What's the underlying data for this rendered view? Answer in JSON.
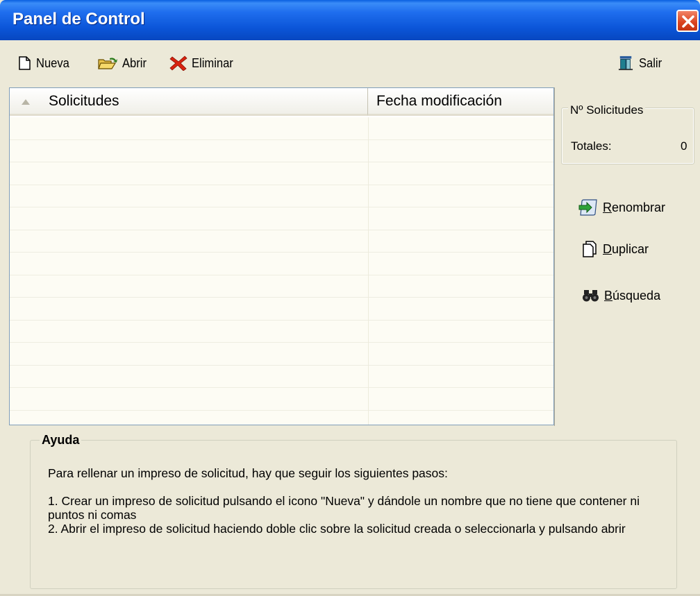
{
  "window": {
    "title": "Panel de Control"
  },
  "toolbar": {
    "new_label": "Nueva",
    "open_label": "Abrir",
    "delete_label": "Eliminar",
    "exit_label": "Salir"
  },
  "list": {
    "columns": [
      "Solicitudes",
      "Fecha modificación"
    ],
    "sorted_column": "Solicitudes",
    "rows": []
  },
  "counts": {
    "group_title": "Nº Solicitudes",
    "totals_label": "Totales:",
    "totals_value": "0"
  },
  "actions": {
    "rename_label": "enombrar",
    "rename_accel": "R",
    "duplicate_label": "uplicar",
    "duplicate_accel": "D",
    "search_label": "úsqueda",
    "search_accel": "B"
  },
  "help": {
    "title": "Ayuda",
    "intro": "Para rellenar un impreso de solicitud, hay que seguir los siguientes pasos:",
    "step1": "1. Crear un impreso de solicitud pulsando el icono \"Nueva\" y dándole un nombre que no tiene que contener ni puntos ni comas",
    "step2": "2. Abrir el impreso de solicitud haciendo doble clic sobre la solicitud creada o seleccionarla y pulsando abrir"
  },
  "icons": {
    "new": "new-document-icon",
    "open": "open-folder-icon",
    "delete": "delete-x-icon",
    "exit": "exit-door-icon",
    "rename": "rename-icon",
    "duplicate": "duplicate-icon",
    "search": "binoculars-icon",
    "close": "close-icon"
  }
}
